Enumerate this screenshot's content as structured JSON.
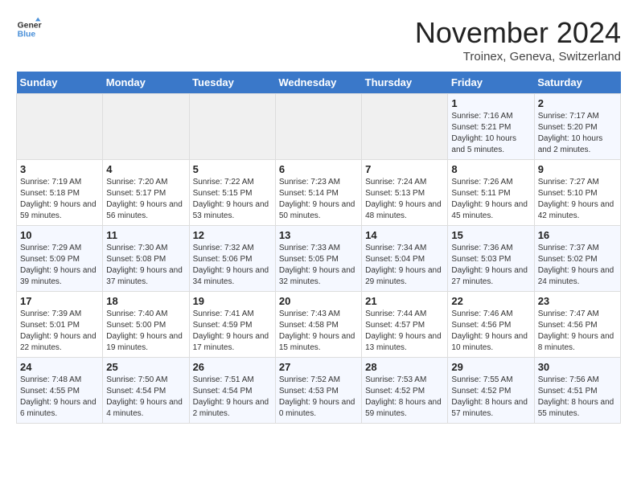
{
  "logo": {
    "text_general": "General",
    "text_blue": "Blue"
  },
  "title": "November 2024",
  "location": "Troinex, Geneva, Switzerland",
  "weekdays": [
    "Sunday",
    "Monday",
    "Tuesday",
    "Wednesday",
    "Thursday",
    "Friday",
    "Saturday"
  ],
  "weeks": [
    [
      {
        "day": "",
        "sunrise": "",
        "sunset": "",
        "daylight": ""
      },
      {
        "day": "",
        "sunrise": "",
        "sunset": "",
        "daylight": ""
      },
      {
        "day": "",
        "sunrise": "",
        "sunset": "",
        "daylight": ""
      },
      {
        "day": "",
        "sunrise": "",
        "sunset": "",
        "daylight": ""
      },
      {
        "day": "",
        "sunrise": "",
        "sunset": "",
        "daylight": ""
      },
      {
        "day": "1",
        "sunrise": "Sunrise: 7:16 AM",
        "sunset": "Sunset: 5:21 PM",
        "daylight": "Daylight: 10 hours and 5 minutes."
      },
      {
        "day": "2",
        "sunrise": "Sunrise: 7:17 AM",
        "sunset": "Sunset: 5:20 PM",
        "daylight": "Daylight: 10 hours and 2 minutes."
      }
    ],
    [
      {
        "day": "3",
        "sunrise": "Sunrise: 7:19 AM",
        "sunset": "Sunset: 5:18 PM",
        "daylight": "Daylight: 9 hours and 59 minutes."
      },
      {
        "day": "4",
        "sunrise": "Sunrise: 7:20 AM",
        "sunset": "Sunset: 5:17 PM",
        "daylight": "Daylight: 9 hours and 56 minutes."
      },
      {
        "day": "5",
        "sunrise": "Sunrise: 7:22 AM",
        "sunset": "Sunset: 5:15 PM",
        "daylight": "Daylight: 9 hours and 53 minutes."
      },
      {
        "day": "6",
        "sunrise": "Sunrise: 7:23 AM",
        "sunset": "Sunset: 5:14 PM",
        "daylight": "Daylight: 9 hours and 50 minutes."
      },
      {
        "day": "7",
        "sunrise": "Sunrise: 7:24 AM",
        "sunset": "Sunset: 5:13 PM",
        "daylight": "Daylight: 9 hours and 48 minutes."
      },
      {
        "day": "8",
        "sunrise": "Sunrise: 7:26 AM",
        "sunset": "Sunset: 5:11 PM",
        "daylight": "Daylight: 9 hours and 45 minutes."
      },
      {
        "day": "9",
        "sunrise": "Sunrise: 7:27 AM",
        "sunset": "Sunset: 5:10 PM",
        "daylight": "Daylight: 9 hours and 42 minutes."
      }
    ],
    [
      {
        "day": "10",
        "sunrise": "Sunrise: 7:29 AM",
        "sunset": "Sunset: 5:09 PM",
        "daylight": "Daylight: 9 hours and 39 minutes."
      },
      {
        "day": "11",
        "sunrise": "Sunrise: 7:30 AM",
        "sunset": "Sunset: 5:08 PM",
        "daylight": "Daylight: 9 hours and 37 minutes."
      },
      {
        "day": "12",
        "sunrise": "Sunrise: 7:32 AM",
        "sunset": "Sunset: 5:06 PM",
        "daylight": "Daylight: 9 hours and 34 minutes."
      },
      {
        "day": "13",
        "sunrise": "Sunrise: 7:33 AM",
        "sunset": "Sunset: 5:05 PM",
        "daylight": "Daylight: 9 hours and 32 minutes."
      },
      {
        "day": "14",
        "sunrise": "Sunrise: 7:34 AM",
        "sunset": "Sunset: 5:04 PM",
        "daylight": "Daylight: 9 hours and 29 minutes."
      },
      {
        "day": "15",
        "sunrise": "Sunrise: 7:36 AM",
        "sunset": "Sunset: 5:03 PM",
        "daylight": "Daylight: 9 hours and 27 minutes."
      },
      {
        "day": "16",
        "sunrise": "Sunrise: 7:37 AM",
        "sunset": "Sunset: 5:02 PM",
        "daylight": "Daylight: 9 hours and 24 minutes."
      }
    ],
    [
      {
        "day": "17",
        "sunrise": "Sunrise: 7:39 AM",
        "sunset": "Sunset: 5:01 PM",
        "daylight": "Daylight: 9 hours and 22 minutes."
      },
      {
        "day": "18",
        "sunrise": "Sunrise: 7:40 AM",
        "sunset": "Sunset: 5:00 PM",
        "daylight": "Daylight: 9 hours and 19 minutes."
      },
      {
        "day": "19",
        "sunrise": "Sunrise: 7:41 AM",
        "sunset": "Sunset: 4:59 PM",
        "daylight": "Daylight: 9 hours and 17 minutes."
      },
      {
        "day": "20",
        "sunrise": "Sunrise: 7:43 AM",
        "sunset": "Sunset: 4:58 PM",
        "daylight": "Daylight: 9 hours and 15 minutes."
      },
      {
        "day": "21",
        "sunrise": "Sunrise: 7:44 AM",
        "sunset": "Sunset: 4:57 PM",
        "daylight": "Daylight: 9 hours and 13 minutes."
      },
      {
        "day": "22",
        "sunrise": "Sunrise: 7:46 AM",
        "sunset": "Sunset: 4:56 PM",
        "daylight": "Daylight: 9 hours and 10 minutes."
      },
      {
        "day": "23",
        "sunrise": "Sunrise: 7:47 AM",
        "sunset": "Sunset: 4:56 PM",
        "daylight": "Daylight: 9 hours and 8 minutes."
      }
    ],
    [
      {
        "day": "24",
        "sunrise": "Sunrise: 7:48 AM",
        "sunset": "Sunset: 4:55 PM",
        "daylight": "Daylight: 9 hours and 6 minutes."
      },
      {
        "day": "25",
        "sunrise": "Sunrise: 7:50 AM",
        "sunset": "Sunset: 4:54 PM",
        "daylight": "Daylight: 9 hours and 4 minutes."
      },
      {
        "day": "26",
        "sunrise": "Sunrise: 7:51 AM",
        "sunset": "Sunset: 4:54 PM",
        "daylight": "Daylight: 9 hours and 2 minutes."
      },
      {
        "day": "27",
        "sunrise": "Sunrise: 7:52 AM",
        "sunset": "Sunset: 4:53 PM",
        "daylight": "Daylight: 9 hours and 0 minutes."
      },
      {
        "day": "28",
        "sunrise": "Sunrise: 7:53 AM",
        "sunset": "Sunset: 4:52 PM",
        "daylight": "Daylight: 8 hours and 59 minutes."
      },
      {
        "day": "29",
        "sunrise": "Sunrise: 7:55 AM",
        "sunset": "Sunset: 4:52 PM",
        "daylight": "Daylight: 8 hours and 57 minutes."
      },
      {
        "day": "30",
        "sunrise": "Sunrise: 7:56 AM",
        "sunset": "Sunset: 4:51 PM",
        "daylight": "Daylight: 8 hours and 55 minutes."
      }
    ]
  ]
}
